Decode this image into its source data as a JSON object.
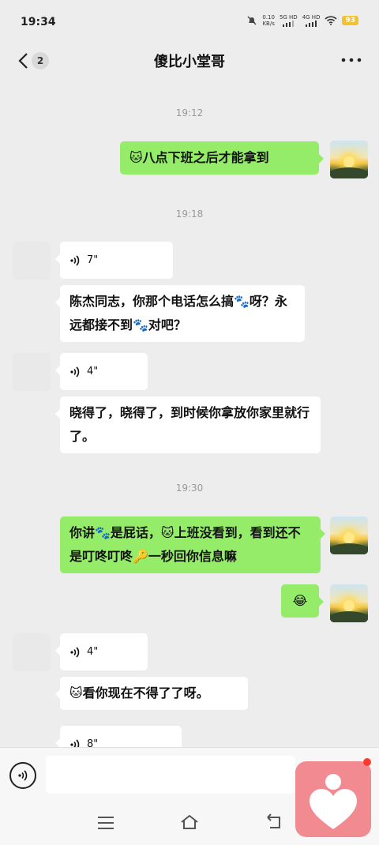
{
  "status_bar": {
    "time": "19:34",
    "net_speed": "0.10",
    "net_unit": "KB/s",
    "net1": "5G HD",
    "net2": "4G HD",
    "battery": "93"
  },
  "header": {
    "unread_count": "2",
    "title": "傻比小堂哥"
  },
  "messages": {
    "t1": "19:12",
    "m1": "🐱八点下班之后才能拿到",
    "t2": "19:18",
    "v1": "7\"",
    "m2": "陈杰同志，你那个电话怎么搞🐾呀？永远都接不到🐾对吧？",
    "v2": "4\"",
    "m3": "晓得了，晓得了，到时候你拿放你家里就行了。",
    "t3": "19:30",
    "m4": "你讲🐾是屁话，🐱上班没看到，看到还不是叮咚叮咚🔑一秒回你信息嘛",
    "m5": "😂",
    "v3": "4\"",
    "m6": "🐱看你现在不得了了呀。",
    "v4": "8\""
  },
  "colors": {
    "my_bubble": "#95ec69",
    "other_bubble": "#ffffff",
    "background": "#ededed"
  }
}
